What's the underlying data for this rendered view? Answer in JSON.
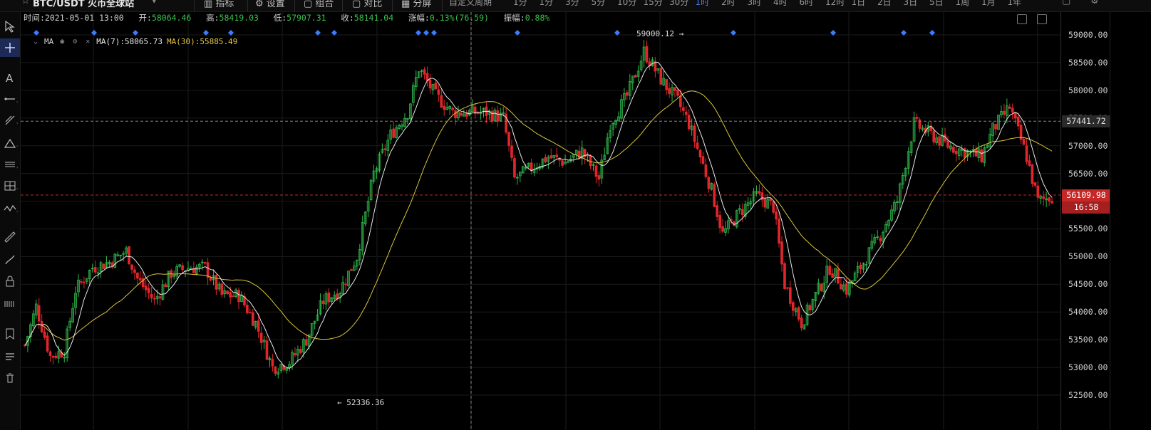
{
  "toolbar": {
    "star": "☆",
    "symbol": "BTC/USDT 火币全球站",
    "indicators": "指标",
    "settings": "设置",
    "template": "组合",
    "compare": "对比",
    "layout": "分屏",
    "custom_period": "自定义周期",
    "timeframes": [
      "1分",
      "1分",
      "3分",
      "5分",
      "10分",
      "15分",
      "30分",
      "1时",
      "2时",
      "3时",
      "4时",
      "6时",
      "12时",
      "1日",
      "2日",
      "3日",
      "5日",
      "1周",
      "1月",
      "1年"
    ],
    "active_timeframe_index": 7
  },
  "info": {
    "time_label": "时间:",
    "time": "2021-05-01 13:00",
    "open_label": "开:",
    "open": "58064.46",
    "high_label": "高:",
    "high": "58419.03",
    "low_label": "低:",
    "low": "57907.31",
    "close_label": "收:",
    "close": "58141.04",
    "change_label": "涨幅:",
    "change": "0.13%(76.59)",
    "amplitude_label": "振幅:",
    "amplitude": "0.88%"
  },
  "ma": {
    "name": "MA",
    "ma7_label": "MA(7):58065.73",
    "ma30_label": "MA(30):55885.49"
  },
  "colors": {
    "up": "#2fb84b",
    "down": "#e0262b",
    "ma7": "#e8e8e8",
    "ma30": "#d9c43a",
    "marker": "#3c7bff",
    "last_price_line": "#c62828"
  },
  "axis": {
    "labels": [
      "59000.00",
      "58500.00",
      "58000.00",
      "57500.00",
      "57000.00",
      "56500.00",
      "56000.00",
      "55500.00",
      "55000.00",
      "54500.00",
      "54000.00",
      "53500.00",
      "53000.00",
      "52500.00"
    ],
    "crosshair_price": "57441.72",
    "last_price": "56109.98",
    "countdown": "16:58"
  },
  "annotations": {
    "max_label": "59000.12 →",
    "min_label": "← 52336.36"
  },
  "chart_data": {
    "type": "candlestick",
    "symbol": "BTC/USDT",
    "y_range": [
      52300,
      59200
    ],
    "y_ticks": [
      59000,
      58500,
      58000,
      57500,
      57000,
      56500,
      56000,
      55500,
      55000,
      54500,
      54000,
      53500,
      53000,
      52500
    ],
    "high_marker": 59000.12,
    "low_marker": 52336.36,
    "last_price": 56109.98,
    "crosshair_price": 57441.72,
    "close_path": [
      [
        0,
        53400
      ],
      [
        4,
        54100
      ],
      [
        9,
        53200
      ],
      [
        14,
        53300
      ],
      [
        18,
        54400
      ],
      [
        24,
        54800
      ],
      [
        30,
        54900
      ],
      [
        36,
        55100
      ],
      [
        40,
        54600
      ],
      [
        46,
        54200
      ],
      [
        52,
        54700
      ],
      [
        58,
        54800
      ],
      [
        64,
        54800
      ],
      [
        70,
        54300
      ],
      [
        76,
        54300
      ],
      [
        82,
        53800
      ],
      [
        88,
        53000
      ],
      [
        94,
        53100
      ],
      [
        100,
        53500
      ],
      [
        106,
        54200
      ],
      [
        112,
        54400
      ],
      [
        118,
        55000
      ],
      [
        124,
        56500
      ],
      [
        130,
        57200
      ],
      [
        136,
        57600
      ],
      [
        140,
        58400
      ],
      [
        146,
        57900
      ],
      [
        152,
        57600
      ],
      [
        158,
        57600
      ],
      [
        164,
        57600
      ],
      [
        170,
        57500
      ],
      [
        174,
        56400
      ],
      [
        180,
        56600
      ],
      [
        186,
        56800
      ],
      [
        192,
        56700
      ],
      [
        198,
        56900
      ],
      [
        204,
        56400
      ],
      [
        208,
        57400
      ],
      [
        214,
        57900
      ],
      [
        220,
        58700
      ],
      [
        226,
        58200
      ],
      [
        232,
        57800
      ],
      [
        236,
        57400
      ],
      [
        240,
        56800
      ],
      [
        244,
        56200
      ],
      [
        248,
        55400
      ],
      [
        254,
        55800
      ],
      [
        260,
        56100
      ],
      [
        266,
        55900
      ],
      [
        270,
        54500
      ],
      [
        276,
        53800
      ],
      [
        280,
        54200
      ],
      [
        286,
        54800
      ],
      [
        292,
        54400
      ],
      [
        298,
        54900
      ],
      [
        304,
        55400
      ],
      [
        310,
        56000
      ],
      [
        316,
        57400
      ],
      [
        322,
        57200
      ],
      [
        328,
        57000
      ],
      [
        334,
        56900
      ],
      [
        340,
        56800
      ],
      [
        344,
        57300
      ],
      [
        350,
        57700
      ],
      [
        356,
        56800
      ],
      [
        360,
        56000
      ],
      [
        366,
        56100
      ]
    ],
    "up_color": "#2fb84b",
    "down_color": "#e0262b",
    "series": [
      {
        "name": "MA(7)",
        "color": "#e8e8e8"
      },
      {
        "name": "MA(30)",
        "color": "#d9c43a"
      }
    ]
  }
}
